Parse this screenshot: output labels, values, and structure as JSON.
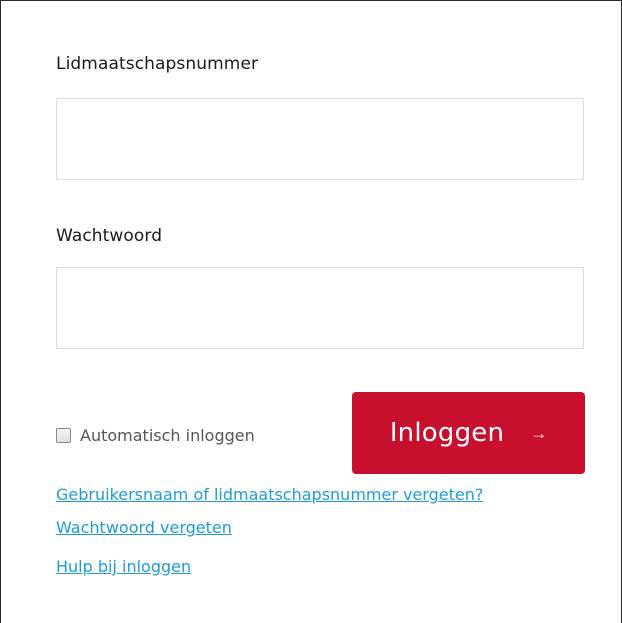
{
  "form": {
    "member_number_label": "Lidmaatschapsnummer",
    "member_number_value": "",
    "password_label": "Wachtwoord",
    "password_value": "",
    "auto_login_label": "Automatisch inloggen",
    "auto_login_checked": false,
    "login_button_label": "Inloggen",
    "login_button_icon": "arrow-right-icon"
  },
  "links": {
    "forgot_username": "Gebruikersnaam of lidmaatschapsnummer vergeten?",
    "forgot_password": "Wachtwoord vergeten",
    "help": "Hulp bij inloggen"
  },
  "colors": {
    "button": "#c8102e",
    "link": "#1e9cd7"
  }
}
